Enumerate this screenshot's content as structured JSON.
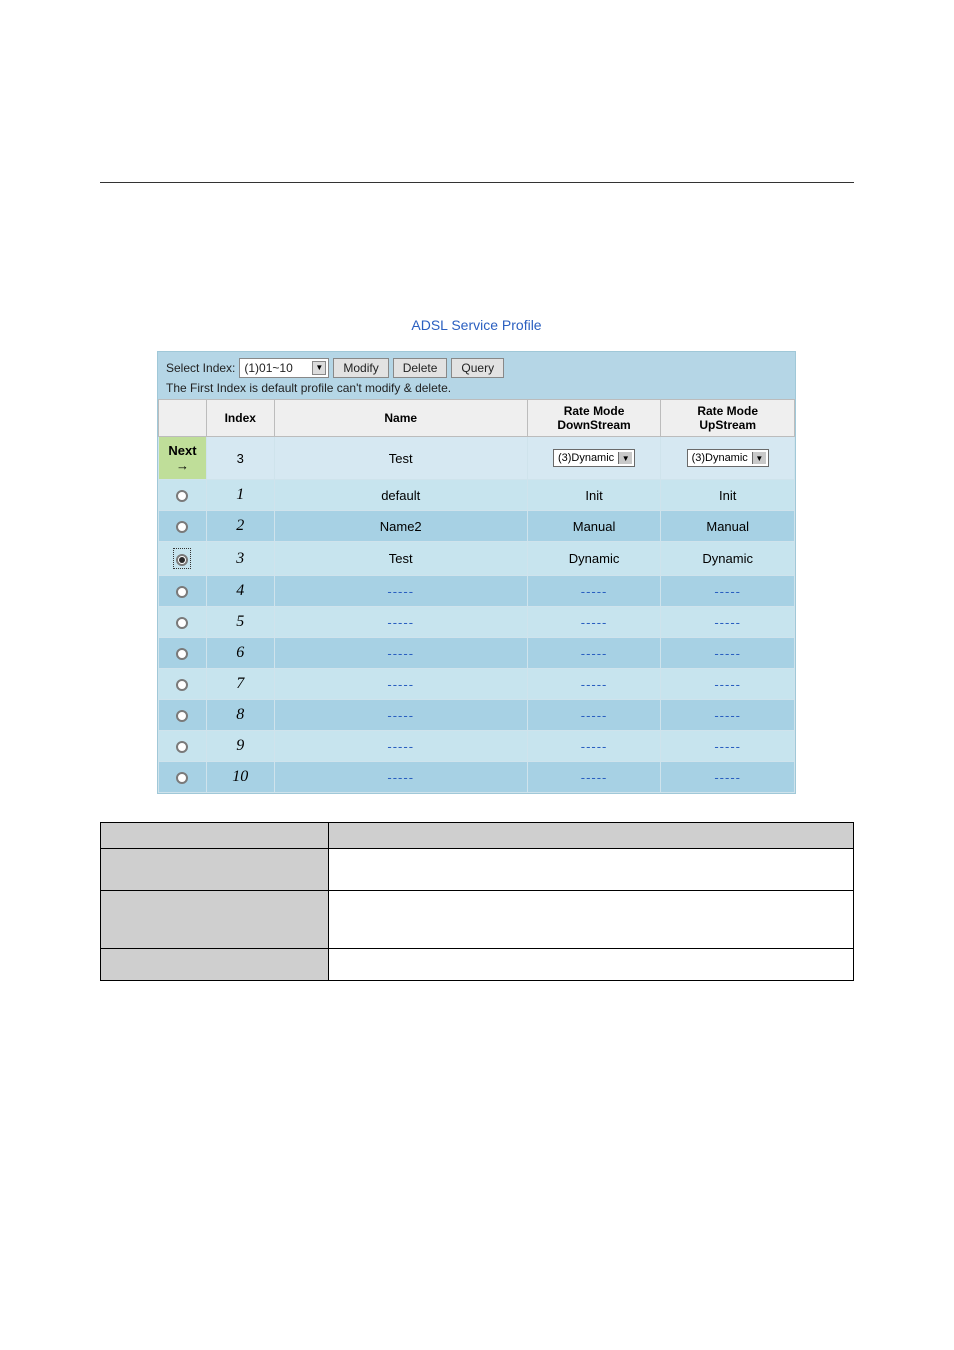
{
  "panel": {
    "title": "ADSL Service Profile",
    "toolbar": {
      "select_label": "Select Index:",
      "select_value": "(1)01~10",
      "modify": "Modify",
      "delete": "Delete",
      "query": "Query",
      "note": "The First Index is default profile can't modify & delete."
    },
    "headers": {
      "index": "Index",
      "name": "Name",
      "down": "Rate Mode DownStream",
      "up": "Rate Mode UpStream"
    },
    "next": {
      "label": "Next →",
      "index": "3",
      "name": "Test",
      "down": "(3)Dynamic",
      "up": "(3)Dynamic"
    },
    "rows": [
      {
        "idx": "1",
        "name": "default",
        "down": "Init",
        "up": "Init",
        "selected": false
      },
      {
        "idx": "2",
        "name": "Name2",
        "down": "Manual",
        "up": "Manual",
        "selected": false
      },
      {
        "idx": "3",
        "name": "Test",
        "down": "Dynamic",
        "up": "Dynamic",
        "selected": true
      },
      {
        "idx": "4",
        "name": "-----",
        "down": "-----",
        "up": "-----",
        "selected": false,
        "empty": true
      },
      {
        "idx": "5",
        "name": "-----",
        "down": "-----",
        "up": "-----",
        "selected": false,
        "empty": true
      },
      {
        "idx": "6",
        "name": "-----",
        "down": "-----",
        "up": "-----",
        "selected": false,
        "empty": true
      },
      {
        "idx": "7",
        "name": "-----",
        "down": "-----",
        "up": "-----",
        "selected": false,
        "empty": true
      },
      {
        "idx": "8",
        "name": "-----",
        "down": "-----",
        "up": "-----",
        "selected": false,
        "empty": true
      },
      {
        "idx": "9",
        "name": "-----",
        "down": "-----",
        "up": "-----",
        "selected": false,
        "empty": true
      },
      {
        "idx": "10",
        "name": "-----",
        "down": "-----",
        "up": "-----",
        "selected": false,
        "empty": true
      }
    ]
  }
}
